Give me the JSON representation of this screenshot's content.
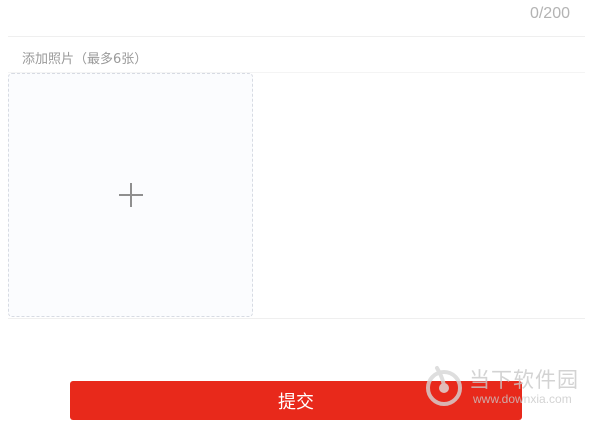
{
  "description_counter": "0/200",
  "photos": {
    "label": "添加照片（最多6张）",
    "add_icon": "plus-icon"
  },
  "submit": {
    "label": "提交",
    "color": "#e8291b"
  },
  "watermark": {
    "name": "当下软件园",
    "url": "www.downxia.com"
  }
}
